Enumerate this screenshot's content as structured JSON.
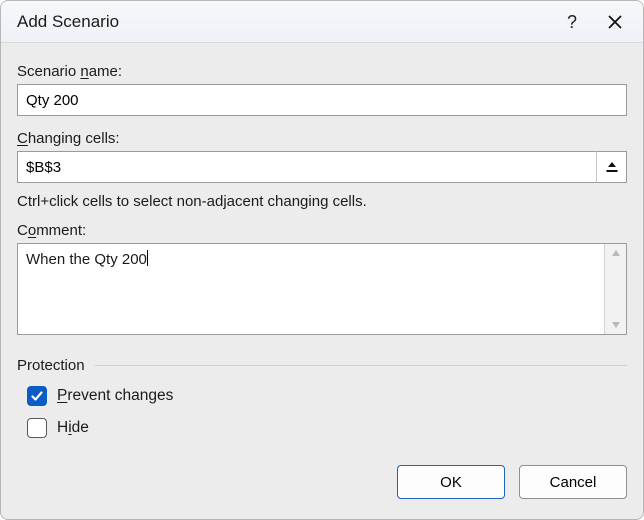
{
  "dialog": {
    "title": "Add Scenario",
    "help_label": "?",
    "close_label": "Close"
  },
  "scenario_name": {
    "label_pre": "Scenario ",
    "label_u": "n",
    "label_post": "ame:",
    "value": "Qty 200"
  },
  "changing_cells": {
    "label_pre": "",
    "label_u": "C",
    "label_post": "hanging cells:",
    "value": "$B$3",
    "hint": "Ctrl+click cells to select non-adjacent changing cells."
  },
  "comment": {
    "label_pre": "C",
    "label_u": "o",
    "label_post": "mment:",
    "value": "When the Qty 200"
  },
  "protection": {
    "header": "Protection",
    "prevent": {
      "label_u": "P",
      "label_post": "revent changes",
      "checked": true
    },
    "hide": {
      "label_pre": "H",
      "label_u": "i",
      "label_post": "de",
      "checked": false
    }
  },
  "buttons": {
    "ok": "OK",
    "cancel": "Cancel"
  }
}
